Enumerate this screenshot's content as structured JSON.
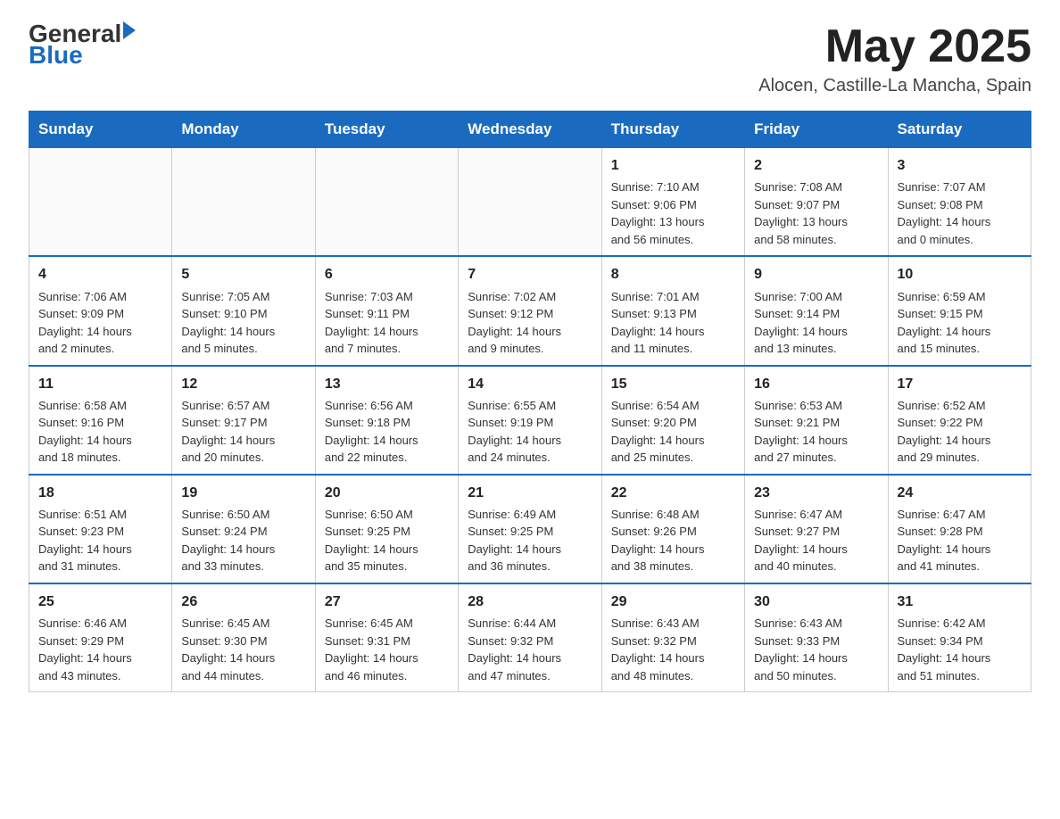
{
  "header": {
    "logo_general": "General",
    "logo_blue": "Blue",
    "title": "May 2025",
    "location": "Alocen, Castille-La Mancha, Spain"
  },
  "days_of_week": [
    "Sunday",
    "Monday",
    "Tuesday",
    "Wednesday",
    "Thursday",
    "Friday",
    "Saturday"
  ],
  "weeks": [
    {
      "cells": [
        {
          "day": "",
          "info": ""
        },
        {
          "day": "",
          "info": ""
        },
        {
          "day": "",
          "info": ""
        },
        {
          "day": "",
          "info": ""
        },
        {
          "day": "1",
          "info": "Sunrise: 7:10 AM\nSunset: 9:06 PM\nDaylight: 13 hours\nand 56 minutes."
        },
        {
          "day": "2",
          "info": "Sunrise: 7:08 AM\nSunset: 9:07 PM\nDaylight: 13 hours\nand 58 minutes."
        },
        {
          "day": "3",
          "info": "Sunrise: 7:07 AM\nSunset: 9:08 PM\nDaylight: 14 hours\nand 0 minutes."
        }
      ]
    },
    {
      "cells": [
        {
          "day": "4",
          "info": "Sunrise: 7:06 AM\nSunset: 9:09 PM\nDaylight: 14 hours\nand 2 minutes."
        },
        {
          "day": "5",
          "info": "Sunrise: 7:05 AM\nSunset: 9:10 PM\nDaylight: 14 hours\nand 5 minutes."
        },
        {
          "day": "6",
          "info": "Sunrise: 7:03 AM\nSunset: 9:11 PM\nDaylight: 14 hours\nand 7 minutes."
        },
        {
          "day": "7",
          "info": "Sunrise: 7:02 AM\nSunset: 9:12 PM\nDaylight: 14 hours\nand 9 minutes."
        },
        {
          "day": "8",
          "info": "Sunrise: 7:01 AM\nSunset: 9:13 PM\nDaylight: 14 hours\nand 11 minutes."
        },
        {
          "day": "9",
          "info": "Sunrise: 7:00 AM\nSunset: 9:14 PM\nDaylight: 14 hours\nand 13 minutes."
        },
        {
          "day": "10",
          "info": "Sunrise: 6:59 AM\nSunset: 9:15 PM\nDaylight: 14 hours\nand 15 minutes."
        }
      ]
    },
    {
      "cells": [
        {
          "day": "11",
          "info": "Sunrise: 6:58 AM\nSunset: 9:16 PM\nDaylight: 14 hours\nand 18 minutes."
        },
        {
          "day": "12",
          "info": "Sunrise: 6:57 AM\nSunset: 9:17 PM\nDaylight: 14 hours\nand 20 minutes."
        },
        {
          "day": "13",
          "info": "Sunrise: 6:56 AM\nSunset: 9:18 PM\nDaylight: 14 hours\nand 22 minutes."
        },
        {
          "day": "14",
          "info": "Sunrise: 6:55 AM\nSunset: 9:19 PM\nDaylight: 14 hours\nand 24 minutes."
        },
        {
          "day": "15",
          "info": "Sunrise: 6:54 AM\nSunset: 9:20 PM\nDaylight: 14 hours\nand 25 minutes."
        },
        {
          "day": "16",
          "info": "Sunrise: 6:53 AM\nSunset: 9:21 PM\nDaylight: 14 hours\nand 27 minutes."
        },
        {
          "day": "17",
          "info": "Sunrise: 6:52 AM\nSunset: 9:22 PM\nDaylight: 14 hours\nand 29 minutes."
        }
      ]
    },
    {
      "cells": [
        {
          "day": "18",
          "info": "Sunrise: 6:51 AM\nSunset: 9:23 PM\nDaylight: 14 hours\nand 31 minutes."
        },
        {
          "day": "19",
          "info": "Sunrise: 6:50 AM\nSunset: 9:24 PM\nDaylight: 14 hours\nand 33 minutes."
        },
        {
          "day": "20",
          "info": "Sunrise: 6:50 AM\nSunset: 9:25 PM\nDaylight: 14 hours\nand 35 minutes."
        },
        {
          "day": "21",
          "info": "Sunrise: 6:49 AM\nSunset: 9:25 PM\nDaylight: 14 hours\nand 36 minutes."
        },
        {
          "day": "22",
          "info": "Sunrise: 6:48 AM\nSunset: 9:26 PM\nDaylight: 14 hours\nand 38 minutes."
        },
        {
          "day": "23",
          "info": "Sunrise: 6:47 AM\nSunset: 9:27 PM\nDaylight: 14 hours\nand 40 minutes."
        },
        {
          "day": "24",
          "info": "Sunrise: 6:47 AM\nSunset: 9:28 PM\nDaylight: 14 hours\nand 41 minutes."
        }
      ]
    },
    {
      "cells": [
        {
          "day": "25",
          "info": "Sunrise: 6:46 AM\nSunset: 9:29 PM\nDaylight: 14 hours\nand 43 minutes."
        },
        {
          "day": "26",
          "info": "Sunrise: 6:45 AM\nSunset: 9:30 PM\nDaylight: 14 hours\nand 44 minutes."
        },
        {
          "day": "27",
          "info": "Sunrise: 6:45 AM\nSunset: 9:31 PM\nDaylight: 14 hours\nand 46 minutes."
        },
        {
          "day": "28",
          "info": "Sunrise: 6:44 AM\nSunset: 9:32 PM\nDaylight: 14 hours\nand 47 minutes."
        },
        {
          "day": "29",
          "info": "Sunrise: 6:43 AM\nSunset: 9:32 PM\nDaylight: 14 hours\nand 48 minutes."
        },
        {
          "day": "30",
          "info": "Sunrise: 6:43 AM\nSunset: 9:33 PM\nDaylight: 14 hours\nand 50 minutes."
        },
        {
          "day": "31",
          "info": "Sunrise: 6:42 AM\nSunset: 9:34 PM\nDaylight: 14 hours\nand 51 minutes."
        }
      ]
    }
  ]
}
